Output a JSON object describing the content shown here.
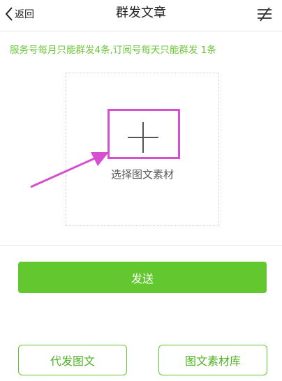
{
  "header": {
    "back_label": "返回",
    "title": "群发文章",
    "menu_icon": "edit-list-icon"
  },
  "notice": {
    "text": "服务号每月只能群发4条,订阅号每天只能群发 1条",
    "color": "#6cc63b"
  },
  "upload": {
    "label": "选择图文素材",
    "icon": "plus-icon"
  },
  "annotation": {
    "color": "#d64fd0"
  },
  "actions": {
    "send_label": "发送",
    "proxy_label": "代发图文",
    "library_label": "图文素材库",
    "accent_color": "#63c82f"
  }
}
